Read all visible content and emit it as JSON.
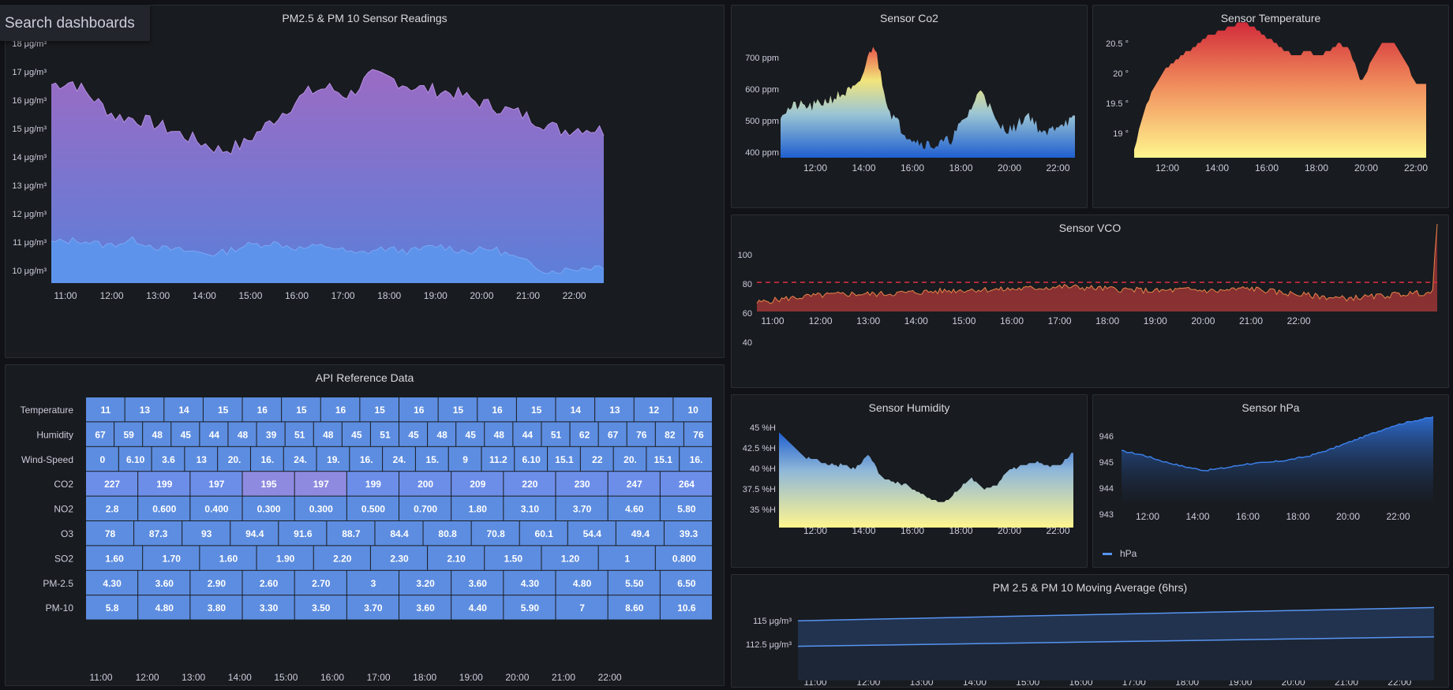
{
  "search": {
    "label": "Search dashboards"
  },
  "colors": {
    "bg": "#111217",
    "panel": "#181b1f",
    "grid": "#2a2d33",
    "axisText": "#ccccdc",
    "purple": "#8e6bbf",
    "blue": "#5794f2",
    "threshold": "#e02f44"
  },
  "panels": {
    "pm": {
      "title": "PM2.5 & PM 10 Sensor Readings",
      "yticks": [
        "18 μg/m³",
        "17 μg/m³",
        "16 μg/m³",
        "15 μg/m³",
        "14 μg/m³",
        "13 μg/m³",
        "12 μg/m³",
        "11 μg/m³",
        "10 μg/m³"
      ],
      "xticks": [
        "11:00",
        "12:00",
        "13:00",
        "14:00",
        "15:00",
        "16:00",
        "17:00",
        "18:00",
        "19:00",
        "20:00",
        "21:00",
        "22:00"
      ]
    },
    "co2": {
      "title": "Sensor Co2",
      "yticks": [
        "700 ppm",
        "600 ppm",
        "500 ppm",
        "400 ppm"
      ],
      "xticks": [
        "12:00",
        "14:00",
        "16:00",
        "18:00",
        "20:00",
        "22:00"
      ]
    },
    "temp": {
      "title": "Sensor Temperature",
      "yticks": [
        "20.5 °",
        "20 °",
        "19.5 °",
        "19 °"
      ],
      "xticks": [
        "12:00",
        "14:00",
        "16:00",
        "18:00",
        "20:00",
        "22:00"
      ]
    },
    "vco": {
      "title": "Sensor VCO",
      "yticks": [
        "100",
        "80",
        "60",
        "40"
      ],
      "xticks": [
        "11:00",
        "12:00",
        "13:00",
        "14:00",
        "15:00",
        "16:00",
        "17:00",
        "18:00",
        "19:00",
        "20:00",
        "21:00",
        "22:00"
      ]
    },
    "api": {
      "title": "API Reference Data",
      "xticks": [
        "11:00",
        "12:00",
        "13:00",
        "14:00",
        "15:00",
        "16:00",
        "17:00",
        "18:00",
        "19:00",
        "20:00",
        "21:00",
        "22:00"
      ],
      "rows": [
        {
          "label": "Temperature",
          "cells": [
            "11",
            "13",
            "14",
            "15",
            "16",
            "15",
            "16",
            "15",
            "16",
            "15",
            "16",
            "15",
            "14",
            "13",
            "12",
            "10"
          ]
        },
        {
          "label": "Humidity",
          "cells": [
            "67",
            "59",
            "48",
            "45",
            "44",
            "48",
            "39",
            "51",
            "48",
            "45",
            "51",
            "45",
            "48",
            "45",
            "48",
            "44",
            "51",
            "62",
            "67",
            "76",
            "82",
            "76"
          ]
        },
        {
          "label": "Wind-Speed",
          "cells": [
            "0",
            "6.10",
            "3.6",
            "13",
            "20.",
            "16.",
            "24.",
            "19.",
            "16.",
            "24.",
            "15.",
            "9",
            "11.2",
            "6.10",
            "15.1",
            "22",
            "20.",
            "15.1",
            "16."
          ]
        },
        {
          "label": "CO2",
          "cells": [
            "227",
            "199",
            "197",
            "195",
            "197",
            "199",
            "200",
            "209",
            "220",
            "230",
            "247",
            "264"
          ]
        },
        {
          "label": "NO2",
          "cells": [
            "2.8",
            "0.600",
            "0.400",
            "0.300",
            "0.300",
            "0.500",
            "0.700",
            "1.80",
            "3.10",
            "3.70",
            "4.60",
            "5.80"
          ]
        },
        {
          "label": "O3",
          "cells": [
            "78",
            "87.3",
            "93",
            "94.4",
            "91.6",
            "88.7",
            "84.4",
            "80.8",
            "70.8",
            "60.1",
            "54.4",
            "49.4",
            "39.3"
          ]
        },
        {
          "label": "SO2",
          "cells": [
            "1.60",
            "1.70",
            "1.60",
            "1.90",
            "2.20",
            "2.30",
            "2.10",
            "1.50",
            "1.20",
            "1",
            "0.800"
          ]
        },
        {
          "label": "PM-2.5",
          "cells": [
            "4.30",
            "3.60",
            "2.90",
            "2.60",
            "2.70",
            "3",
            "3.20",
            "3.60",
            "4.30",
            "4.80",
            "5.50",
            "6.50"
          ]
        },
        {
          "label": "PM-10",
          "cells": [
            "5.8",
            "4.80",
            "3.80",
            "3.30",
            "3.50",
            "3.70",
            "3.60",
            "4.40",
            "5.90",
            "7",
            "8.60",
            "10.6"
          ]
        }
      ]
    },
    "hum": {
      "title": "Sensor Humidity",
      "yticks": [
        "45 %H",
        "42.5 %H",
        "40 %H",
        "37.5 %H",
        "35 %H"
      ],
      "xticks": [
        "12:00",
        "14:00",
        "16:00",
        "18:00",
        "20:00",
        "22:00"
      ]
    },
    "hpa": {
      "title": "Sensor hPa",
      "yticks": [
        "946",
        "945",
        "944",
        "943"
      ],
      "xticks": [
        "12:00",
        "14:00",
        "16:00",
        "18:00",
        "20:00",
        "22:00"
      ],
      "legend": "hPa"
    },
    "avg": {
      "title": "PM 2.5 & PM 10 Moving Average (6hrs)",
      "yticks": [
        "115 μg/m³",
        "112.5 μg/m³"
      ],
      "xticks": [
        "11:00",
        "12:00",
        "13:00",
        "14:00",
        "15:00",
        "16:00",
        "17:00",
        "18:00",
        "19:00",
        "20:00",
        "21:00",
        "22:00"
      ]
    }
  }
}
